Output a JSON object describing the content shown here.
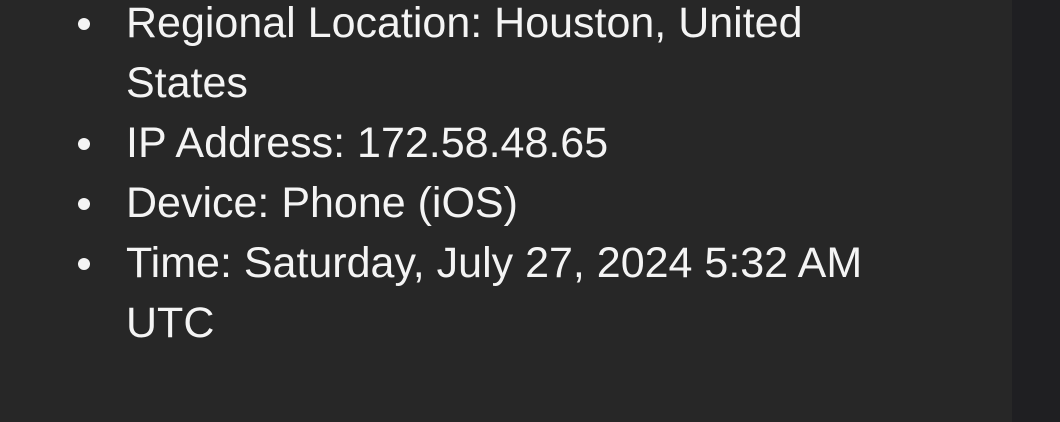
{
  "details": {
    "items": [
      {
        "text": "Regional Location: Houston, United States"
      },
      {
        "text": "IP Address: 172.58.48.65"
      },
      {
        "text": "Device: Phone (iOS)"
      },
      {
        "text": "Time: Saturday, July 27, 2024 5:32 AM UTC"
      }
    ]
  },
  "colors": {
    "background": "#272727",
    "text": "#f4f4f4",
    "side_strip": "#1f1f22"
  }
}
